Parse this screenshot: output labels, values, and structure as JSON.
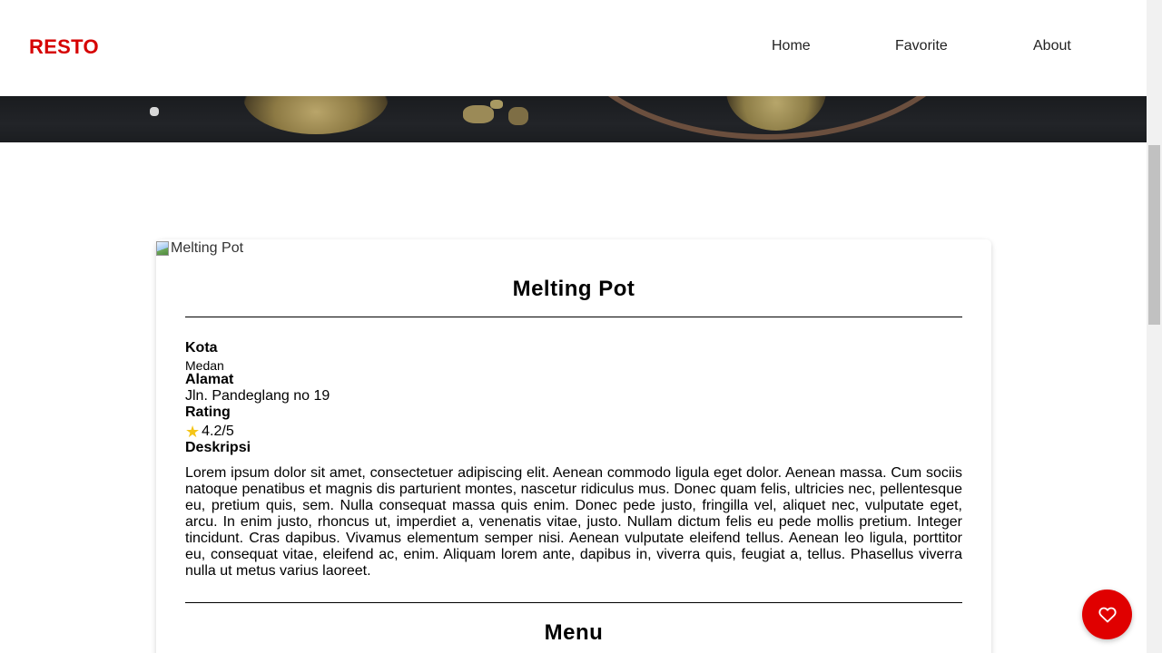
{
  "header": {
    "brand": "RESTO",
    "nav": [
      {
        "label": "Home"
      },
      {
        "label": "Favorite"
      },
      {
        "label": "About"
      }
    ]
  },
  "restaurant": {
    "image_alt": "Melting Pot",
    "name": "Melting Pot",
    "city_label": "Kota",
    "city": "Medan",
    "address_label": "Alamat",
    "address": "Jln. Pandeglang no 19",
    "rating_label": "Rating",
    "rating": "4.2/5",
    "rating_icon": "star-icon",
    "description_label": "Deskripsi",
    "description": "Lorem ipsum dolor sit amet, consectetuer adipiscing elit. Aenean commodo ligula eget dolor. Aenean massa. Cum sociis natoque penatibus et magnis dis parturient montes, nascetur ridiculus mus. Donec quam felis, ultricies nec, pellentesque eu, pretium quis, sem. Nulla consequat massa quis enim. Donec pede justo, fringilla vel, aliquet nec, vulputate eget, arcu. In enim justo, rhoncus ut, imperdiet a, venenatis vitae, justo. Nullam dictum felis eu pede mollis pretium. Integer tincidunt. Cras dapibus. Vivamus elementum semper nisi. Aenean vulputate eleifend tellus. Aenean leo ligula, porttitor eu, consequat vitae, eleifend ac, enim. Aliquam lorem ante, dapibus in, viverra quis, feugiat a, tellus. Phasellus viverra nulla ut metus varius laoreet.",
    "menu_heading": "Menu"
  },
  "favorite_button": {
    "icon": "heart-icon"
  },
  "colors": {
    "brand": "#d60000",
    "fab": "#e00000",
    "star": "#f5c518"
  }
}
